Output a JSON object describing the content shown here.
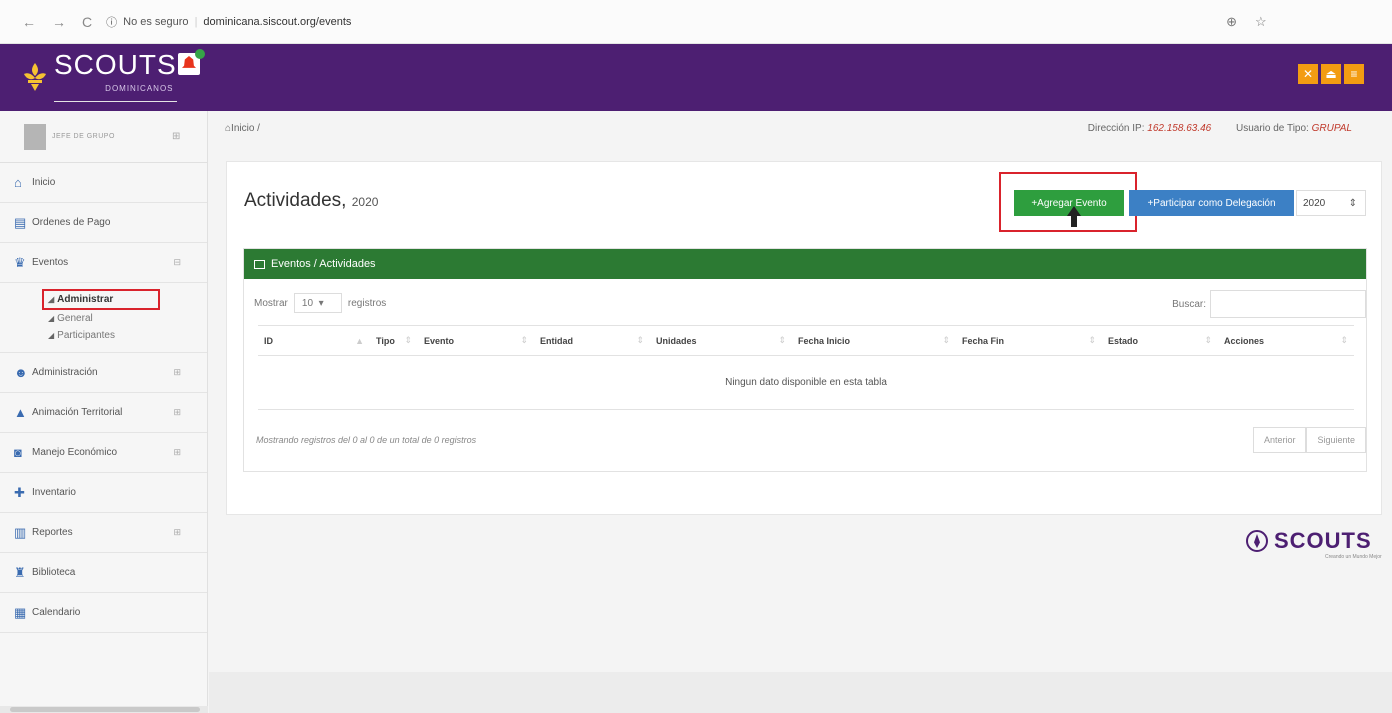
{
  "browser": {
    "back": "←",
    "forward": "→",
    "reload": "C",
    "security": "No es seguro",
    "url": "dominicana.siscout.org/events",
    "zoom_icon": "zoom-icon",
    "star_icon": "star-icon"
  },
  "header": {
    "brand": "SCOUTS",
    "brand_sub": "DOMINICANOS",
    "buttons": [
      "✕",
      "⏏",
      "≡"
    ],
    "colors": {
      "primary": "#4d1f72",
      "accent": "#f39c12"
    }
  },
  "sidebar": {
    "user": "JEFE DE GRUPO",
    "items": [
      {
        "label": "Inicio"
      },
      {
        "label": "Ordenes de Pago"
      },
      {
        "label": "Eventos"
      },
      {
        "label": "Administración"
      },
      {
        "label": "Animación Territorial"
      },
      {
        "label": "Manejo Económico"
      },
      {
        "label": "Inventario"
      },
      {
        "label": "Reportes"
      },
      {
        "label": "Biblioteca"
      },
      {
        "label": "Calendario"
      }
    ],
    "submenu": [
      "Administrar",
      "General",
      "Participantes"
    ]
  },
  "breadcrumb": {
    "home": "Inicio /"
  },
  "ipinfo": {
    "ip_label": "Dirección IP:",
    "ip_value": "162.158.63.46",
    "type_label": "Usuario de Tipo:",
    "type_value": "GRUPAL"
  },
  "main": {
    "title": "Actividades,",
    "year": "2020",
    "add_button": "+Agregar Evento",
    "delegation_button": "+Participar como Delegación",
    "year_select": "2020",
    "table_title": "Eventos / Actividades",
    "show_label": "Mostrar",
    "show_value": "10",
    "records_label": "registros",
    "search_label": "Buscar:",
    "columns": [
      "ID",
      "Tipo",
      "Evento",
      "Entidad",
      "Unidades",
      "Fecha Inicio",
      "Fecha Fin",
      "Estado",
      "Acciones"
    ],
    "empty": "Ningun dato disponible en esta tabla",
    "info": "Mostrando registros del 0 al 0 de un total de 0 registros",
    "prev": "Anterior",
    "next": "Siguiente"
  },
  "footer": {
    "brand": "SCOUTS",
    "tagline": "Creando un Mundo Mejor"
  }
}
